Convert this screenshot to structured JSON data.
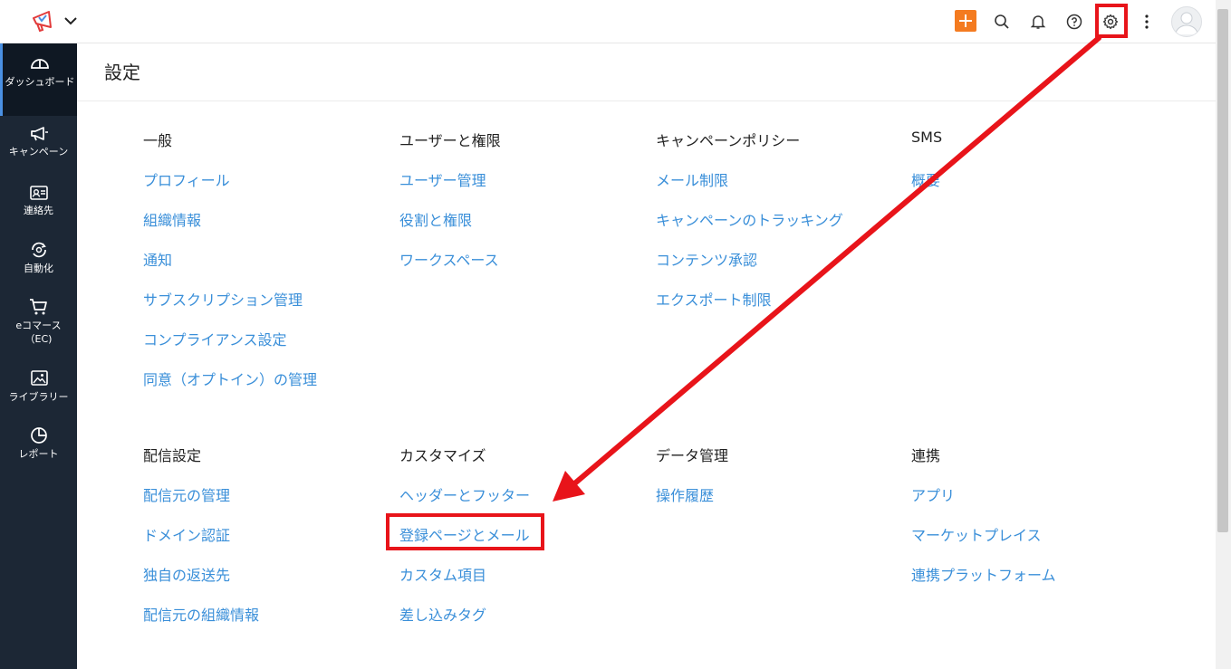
{
  "sidebar": {
    "items": [
      {
        "label": "ダッシュボード",
        "icon": "speedometer-icon"
      },
      {
        "label": "キャンペーン",
        "icon": "megaphone-icon"
      },
      {
        "label": "連絡先",
        "icon": "contact-card-icon"
      },
      {
        "label": "自動化",
        "icon": "automation-icon"
      },
      {
        "label": "eコマース（EC)",
        "icon": "cart-icon"
      },
      {
        "label": "ライブラリー",
        "icon": "image-library-icon"
      },
      {
        "label": "レポート",
        "icon": "pie-chart-icon"
      }
    ]
  },
  "topbar": {
    "icons": [
      "megaphone-logo-icon",
      "chevron-down-icon",
      "plus-icon",
      "search-icon",
      "bell-icon",
      "help-icon",
      "gear-icon",
      "more-vertical-icon",
      "avatar"
    ],
    "accent": "#f47b20"
  },
  "page": {
    "title": "設定"
  },
  "sections": {
    "general": {
      "heading": "一般",
      "links": [
        "プロフィール",
        "組織情報",
        "通知",
        "サブスクリプション管理",
        "コンプライアンス設定",
        "同意（オプトイン）の管理"
      ]
    },
    "users": {
      "heading": "ユーザーと権限",
      "links": [
        "ユーザー管理",
        "役割と権限",
        "ワークスペース"
      ]
    },
    "policy": {
      "heading": "キャンペーンポリシー",
      "links": [
        "メール制限",
        "キャンペーンのトラッキング",
        "コンテンツ承認",
        "エクスポート制限"
      ]
    },
    "sms": {
      "heading": "SMS",
      "links": [
        "概要"
      ]
    },
    "delivery": {
      "heading": "配信設定",
      "links": [
        "配信元の管理",
        "ドメイン認証",
        "独自の返送先",
        "配信元の組織情報"
      ]
    },
    "customize": {
      "heading": "カスタマイズ",
      "links": [
        "ヘッダーとフッター",
        "登録ページとメール",
        "カスタム項目",
        "差し込みタグ"
      ]
    },
    "data": {
      "heading": "データ管理",
      "links": [
        "操作履歴"
      ]
    },
    "integration": {
      "heading": "連携",
      "links": [
        "アプリ",
        "マーケットプレイス",
        "連携プラットフォーム"
      ]
    }
  },
  "colors": {
    "link": "#3a8fd9",
    "sidebar_bg": "#1c2735",
    "highlight": "#e8141a"
  }
}
